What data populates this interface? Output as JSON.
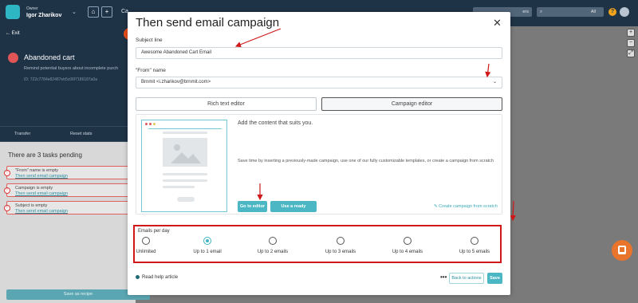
{
  "app": {
    "user_role": "Owner",
    "user_name": "Igor Zharikov",
    "search_scope": "All",
    "bg_crumb": "Ca",
    "bg_search_label": "ers"
  },
  "left_panel": {
    "exit_label": "Exit",
    "flow_title": "Abandoned cart",
    "flow_desc": "Remind potential buyers about incomplete purch",
    "flow_id": "ID: 722c7784e82487eb5c06f7186187a0a",
    "transfer_label": "Transfer",
    "reset_stats_label": "Reset stats",
    "tasks_heading": "There are 3 tasks pending",
    "tasks": [
      {
        "title": "\"From\" name is empty",
        "link": "Then send email campaign"
      },
      {
        "title": "Campaign is empty",
        "link": "Then send email campaign"
      },
      {
        "title": "Subject is empty",
        "link": "Then send email campaign"
      }
    ],
    "save_recipe_label": "Save as recipe"
  },
  "modal": {
    "title": "Then send email campaign",
    "subject_label": "Subject line",
    "subject_value": "Awesome Abandoned Cart Email",
    "from_label": "\"From\" name",
    "from_value": "Brnmit <i.zharikov@brnmit.com>",
    "tabs": [
      {
        "label": "Rich text editor",
        "active": false
      },
      {
        "label": "Campaign editor",
        "active": true
      }
    ],
    "editor": {
      "hint": "Add the content that suits you.",
      "description": "Save time by inserting a previously-made campaign, use one of our fully customizable templates, or create a campaign from scratch",
      "go_to_editor": "Go to editor",
      "use_ready": "Use a ready campaign",
      "create_scratch": "Create campaign from scratch"
    },
    "emails_per_day": {
      "label": "Emails per day",
      "options": [
        "Unlimited",
        "Up to 1 email",
        "Up to 2 emails",
        "Up to 3 emails",
        "Up to 4 emails",
        "Up to 5 emails"
      ],
      "selected_index": 1
    },
    "footer": {
      "read_help": "Read help article",
      "more": "•••",
      "back": "Back to actions",
      "save": "Save"
    }
  },
  "colors": {
    "accent": "#4bb7c4",
    "highlight_border": "#d01818",
    "arrow": "#d01818",
    "navy": "#1f3347"
  }
}
